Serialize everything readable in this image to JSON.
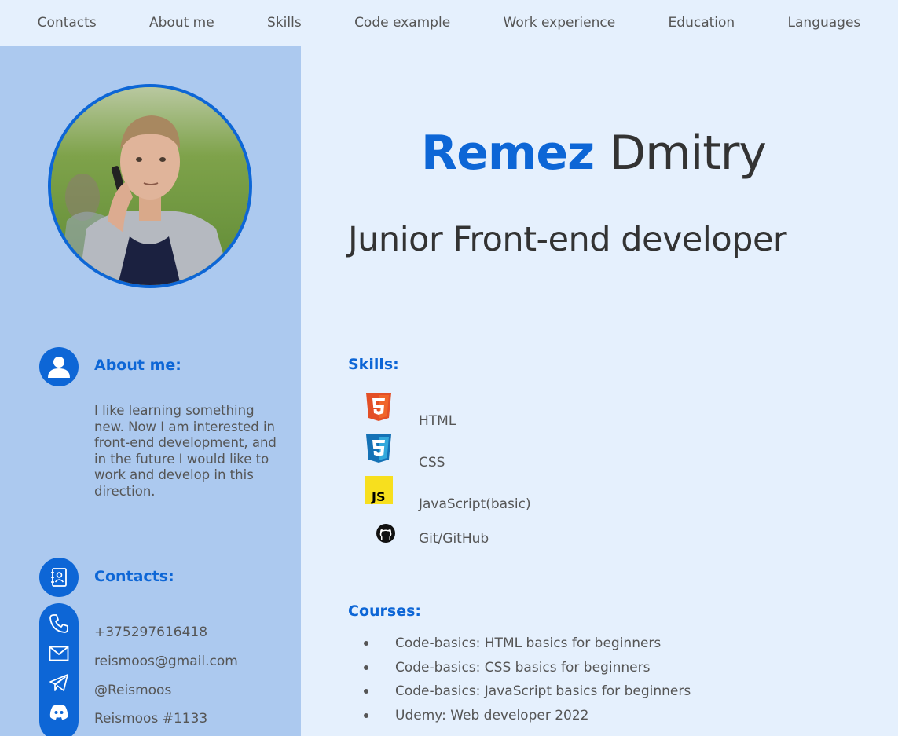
{
  "nav": {
    "items": [
      "Contacts",
      "About me",
      "Skills",
      "Code example",
      "Work experience",
      "Education",
      "Languages"
    ]
  },
  "profile": {
    "first_name": "Remez",
    "last_name": "Dmitry",
    "role": "Junior Front-end developer"
  },
  "about": {
    "title": "About me:",
    "text": "I like learning something new. Now I am interested in front-end development, and in the future I would like to work and develop in this direction."
  },
  "contacts": {
    "title": "Contacts:",
    "phone": "+375297616418",
    "email": "reismoos@gmail.com",
    "telegram": "@Reismoos",
    "discord": "Reismoos #1133"
  },
  "skills": {
    "title": "Skills:",
    "items": [
      {
        "label": "HTML",
        "icon": "html5-icon"
      },
      {
        "label": "CSS",
        "icon": "css3-icon"
      },
      {
        "label": "JavaScript(basic)",
        "icon": "javascript-icon"
      },
      {
        "label": "Git/GitHub",
        "icon": "github-icon"
      }
    ]
  },
  "courses": {
    "title": "Courses:",
    "items": [
      "Code-basics: HTML basics for beginners",
      "Code-basics: CSS basics for beginners",
      "Code-basics: JavaScript basics for beginners",
      "Udemy: Web developer 2022"
    ]
  },
  "colors": {
    "accent": "#0d66d6",
    "sidebar": "#acc9ef",
    "background": "#e5f0fd"
  }
}
